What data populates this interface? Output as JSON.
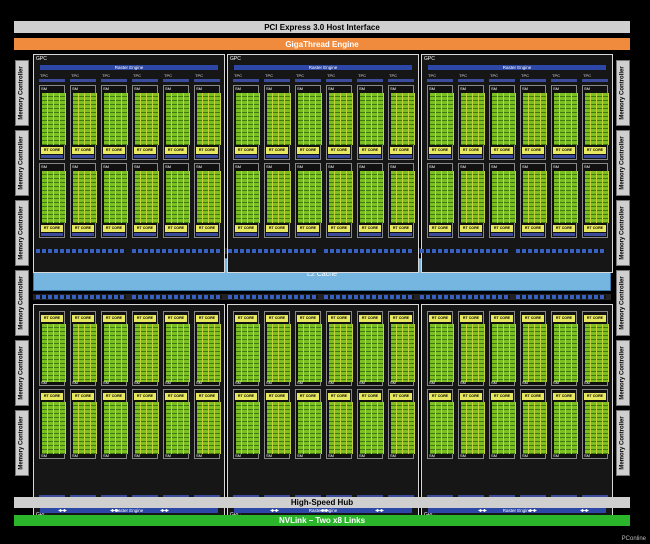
{
  "pcie": "PCI Express 3.0 Host Interface",
  "gigathread": "GigaThread Engine",
  "memory_controller": "Memory Controller",
  "gpc": "GPC",
  "raster_engine": "Raster Engine",
  "tpc": "TPC",
  "polymorph": "PolyMorph Engine",
  "sm": "SM",
  "rt_core": "RT CORE",
  "l2": "L2 Cache",
  "hub": "High-Speed Hub",
  "nvlink": "NVLink – Two x8 Links",
  "watermark": "PConline",
  "colors": {
    "orange": "#f08a3c",
    "green": "#2ab52a",
    "blue": "#75b6e0",
    "yellow": "#e8e860",
    "sm_green": "#7bc020"
  }
}
